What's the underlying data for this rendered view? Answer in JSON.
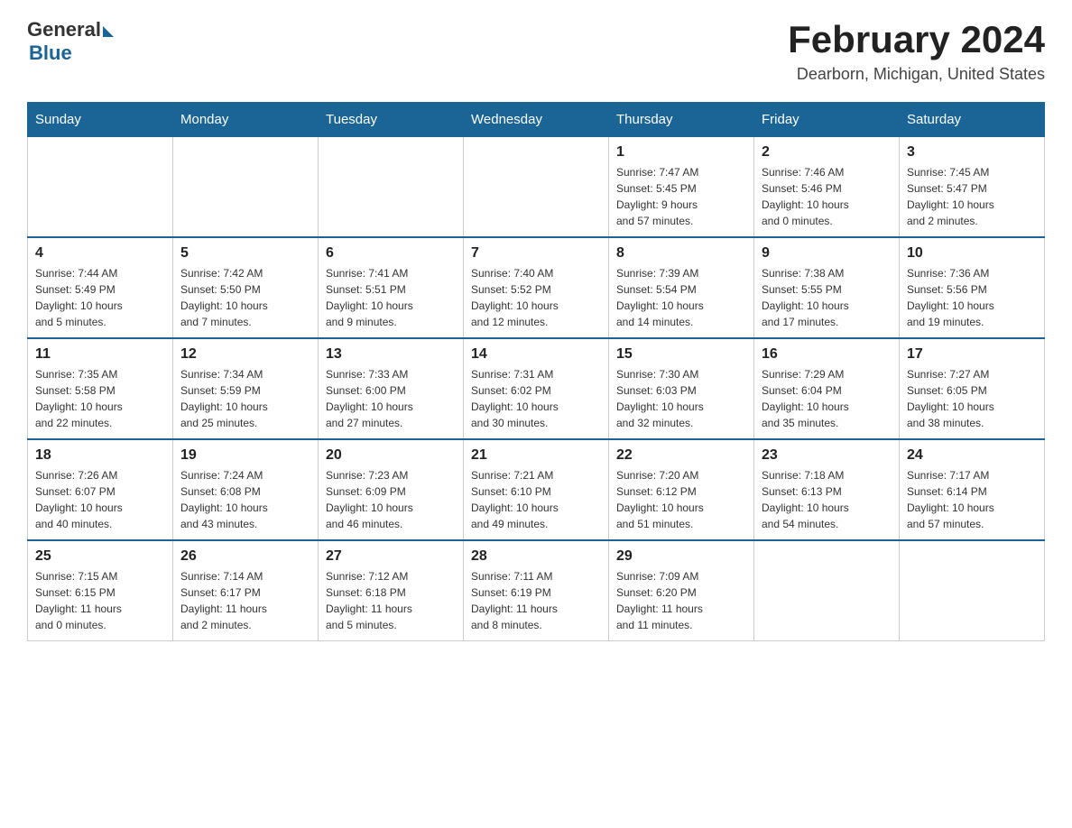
{
  "header": {
    "logo_general": "General",
    "logo_blue": "Blue",
    "title": "February 2024",
    "subtitle": "Dearborn, Michigan, United States"
  },
  "days_of_week": [
    "Sunday",
    "Monday",
    "Tuesday",
    "Wednesday",
    "Thursday",
    "Friday",
    "Saturday"
  ],
  "weeks": [
    [
      {
        "day": "",
        "info": ""
      },
      {
        "day": "",
        "info": ""
      },
      {
        "day": "",
        "info": ""
      },
      {
        "day": "",
        "info": ""
      },
      {
        "day": "1",
        "info": "Sunrise: 7:47 AM\nSunset: 5:45 PM\nDaylight: 9 hours\nand 57 minutes."
      },
      {
        "day": "2",
        "info": "Sunrise: 7:46 AM\nSunset: 5:46 PM\nDaylight: 10 hours\nand 0 minutes."
      },
      {
        "day": "3",
        "info": "Sunrise: 7:45 AM\nSunset: 5:47 PM\nDaylight: 10 hours\nand 2 minutes."
      }
    ],
    [
      {
        "day": "4",
        "info": "Sunrise: 7:44 AM\nSunset: 5:49 PM\nDaylight: 10 hours\nand 5 minutes."
      },
      {
        "day": "5",
        "info": "Sunrise: 7:42 AM\nSunset: 5:50 PM\nDaylight: 10 hours\nand 7 minutes."
      },
      {
        "day": "6",
        "info": "Sunrise: 7:41 AM\nSunset: 5:51 PM\nDaylight: 10 hours\nand 9 minutes."
      },
      {
        "day": "7",
        "info": "Sunrise: 7:40 AM\nSunset: 5:52 PM\nDaylight: 10 hours\nand 12 minutes."
      },
      {
        "day": "8",
        "info": "Sunrise: 7:39 AM\nSunset: 5:54 PM\nDaylight: 10 hours\nand 14 minutes."
      },
      {
        "day": "9",
        "info": "Sunrise: 7:38 AM\nSunset: 5:55 PM\nDaylight: 10 hours\nand 17 minutes."
      },
      {
        "day": "10",
        "info": "Sunrise: 7:36 AM\nSunset: 5:56 PM\nDaylight: 10 hours\nand 19 minutes."
      }
    ],
    [
      {
        "day": "11",
        "info": "Sunrise: 7:35 AM\nSunset: 5:58 PM\nDaylight: 10 hours\nand 22 minutes."
      },
      {
        "day": "12",
        "info": "Sunrise: 7:34 AM\nSunset: 5:59 PM\nDaylight: 10 hours\nand 25 minutes."
      },
      {
        "day": "13",
        "info": "Sunrise: 7:33 AM\nSunset: 6:00 PM\nDaylight: 10 hours\nand 27 minutes."
      },
      {
        "day": "14",
        "info": "Sunrise: 7:31 AM\nSunset: 6:02 PM\nDaylight: 10 hours\nand 30 minutes."
      },
      {
        "day": "15",
        "info": "Sunrise: 7:30 AM\nSunset: 6:03 PM\nDaylight: 10 hours\nand 32 minutes."
      },
      {
        "day": "16",
        "info": "Sunrise: 7:29 AM\nSunset: 6:04 PM\nDaylight: 10 hours\nand 35 minutes."
      },
      {
        "day": "17",
        "info": "Sunrise: 7:27 AM\nSunset: 6:05 PM\nDaylight: 10 hours\nand 38 minutes."
      }
    ],
    [
      {
        "day": "18",
        "info": "Sunrise: 7:26 AM\nSunset: 6:07 PM\nDaylight: 10 hours\nand 40 minutes."
      },
      {
        "day": "19",
        "info": "Sunrise: 7:24 AM\nSunset: 6:08 PM\nDaylight: 10 hours\nand 43 minutes."
      },
      {
        "day": "20",
        "info": "Sunrise: 7:23 AM\nSunset: 6:09 PM\nDaylight: 10 hours\nand 46 minutes."
      },
      {
        "day": "21",
        "info": "Sunrise: 7:21 AM\nSunset: 6:10 PM\nDaylight: 10 hours\nand 49 minutes."
      },
      {
        "day": "22",
        "info": "Sunrise: 7:20 AM\nSunset: 6:12 PM\nDaylight: 10 hours\nand 51 minutes."
      },
      {
        "day": "23",
        "info": "Sunrise: 7:18 AM\nSunset: 6:13 PM\nDaylight: 10 hours\nand 54 minutes."
      },
      {
        "day": "24",
        "info": "Sunrise: 7:17 AM\nSunset: 6:14 PM\nDaylight: 10 hours\nand 57 minutes."
      }
    ],
    [
      {
        "day": "25",
        "info": "Sunrise: 7:15 AM\nSunset: 6:15 PM\nDaylight: 11 hours\nand 0 minutes."
      },
      {
        "day": "26",
        "info": "Sunrise: 7:14 AM\nSunset: 6:17 PM\nDaylight: 11 hours\nand 2 minutes."
      },
      {
        "day": "27",
        "info": "Sunrise: 7:12 AM\nSunset: 6:18 PM\nDaylight: 11 hours\nand 5 minutes."
      },
      {
        "day": "28",
        "info": "Sunrise: 7:11 AM\nSunset: 6:19 PM\nDaylight: 11 hours\nand 8 minutes."
      },
      {
        "day": "29",
        "info": "Sunrise: 7:09 AM\nSunset: 6:20 PM\nDaylight: 11 hours\nand 11 minutes."
      },
      {
        "day": "",
        "info": ""
      },
      {
        "day": "",
        "info": ""
      }
    ]
  ]
}
